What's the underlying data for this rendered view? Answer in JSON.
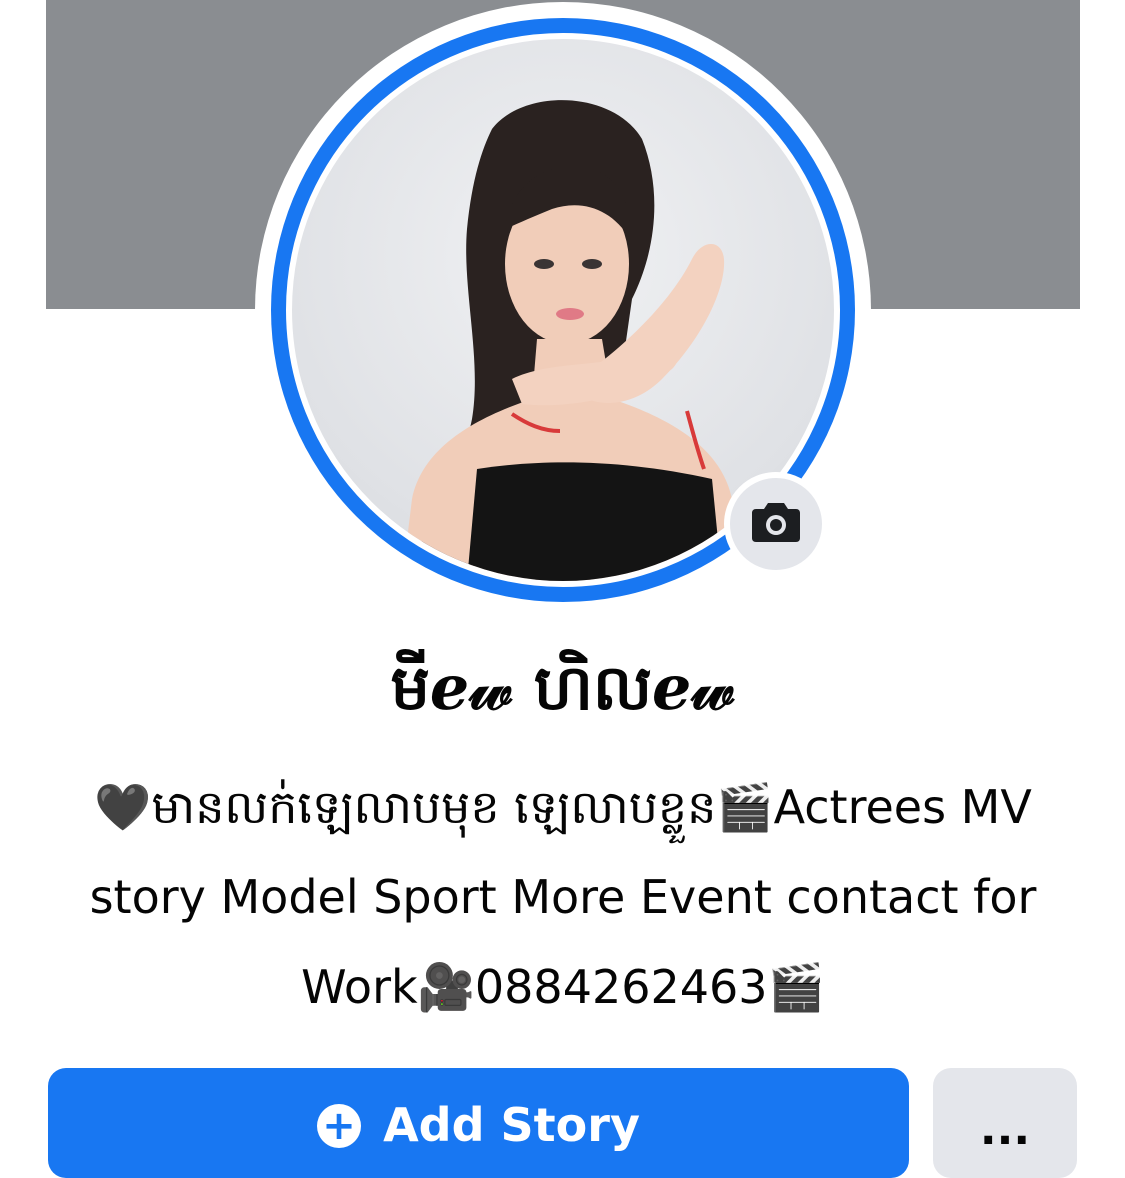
{
  "profile": {
    "name": "មីℯ𝓌 ហិលℯ𝓌",
    "bio": "🖤មានលក់ឡេលាបមុខ ឡេលាបខ្លួន🎬Actrees MV story Model Sport More Event contact for Work🎥0884262463🎬"
  },
  "actions": {
    "add_story_label": "Add Story",
    "more_label": "..."
  },
  "icons": {
    "camera": "camera-icon",
    "plus": "plus-icon",
    "more": "more-icon"
  },
  "colors": {
    "accent": "#1877f2",
    "cover": "#8a8d91",
    "button_secondary": "#e4e6eb"
  }
}
